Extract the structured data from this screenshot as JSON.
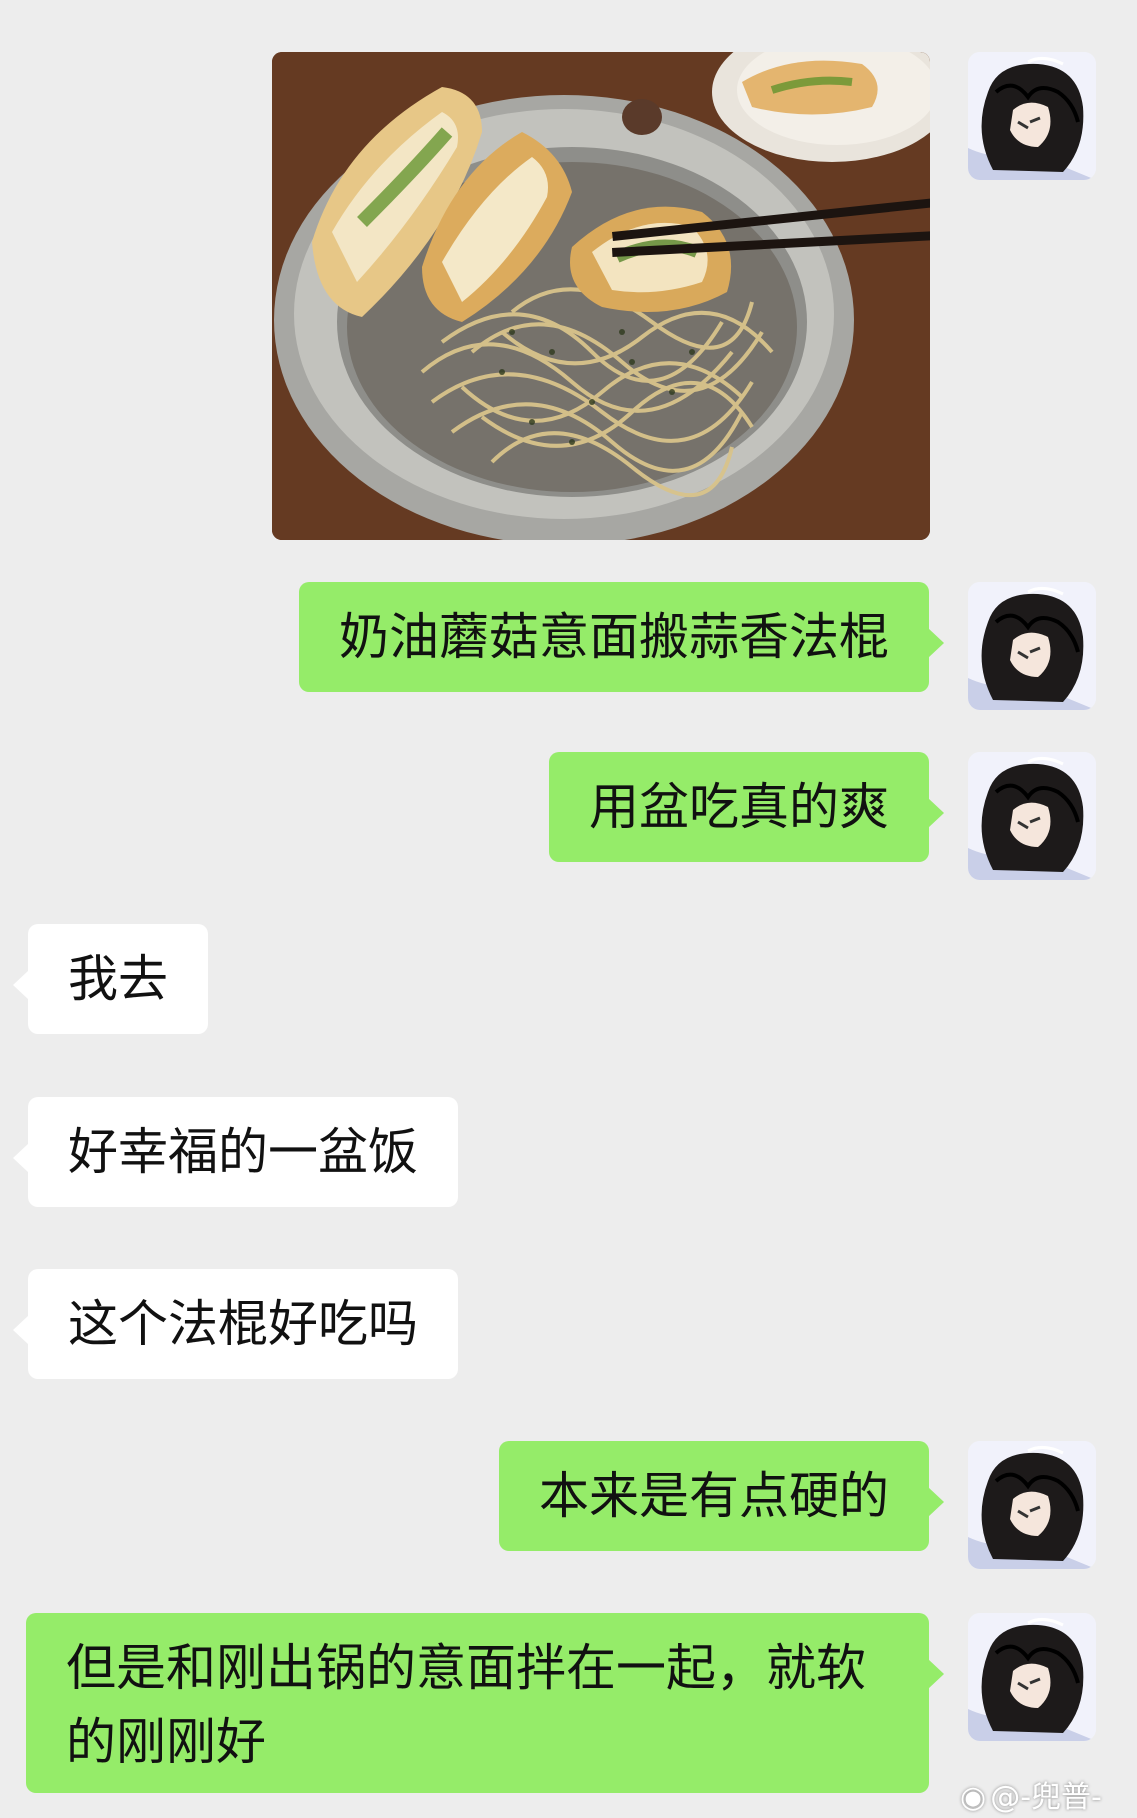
{
  "chat": {
    "messages": [
      {
        "sender": "me",
        "type": "image",
        "image_desc": "photo-of-pasta-and-garlic-bread"
      },
      {
        "sender": "me",
        "type": "text",
        "text": "奶油蘑菇意面搬蒜香法棍"
      },
      {
        "sender": "me",
        "type": "text",
        "text": "用盆吃真的爽"
      },
      {
        "sender": "other",
        "type": "text",
        "text": "我去"
      },
      {
        "sender": "other",
        "type": "text",
        "text": "好幸福的一盆饭"
      },
      {
        "sender": "other",
        "type": "text",
        "text": "这个法棍好吃吗"
      },
      {
        "sender": "me",
        "type": "text",
        "text": "本来是有点硬的"
      },
      {
        "sender": "me",
        "type": "text",
        "text": "但是和刚出锅的意面拌在一起，就软的刚刚好"
      }
    ]
  },
  "watermark": {
    "text": "@-兜普-",
    "icon": "weibo-icon"
  },
  "colors": {
    "background": "#ededed",
    "my_bubble": "#95ec69",
    "other_bubble": "#ffffff"
  }
}
